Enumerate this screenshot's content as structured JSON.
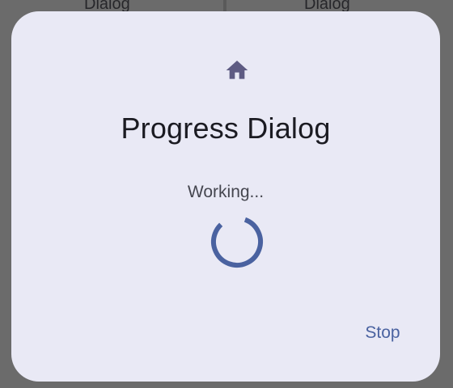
{
  "background": {
    "left_label": "Dialog",
    "right_label": "Dialog"
  },
  "dialog": {
    "icon": "home-icon",
    "title": "Progress Dialog",
    "message": "Working...",
    "progress_indicator": "indeterminate-circular",
    "stop_label": "Stop"
  },
  "colors": {
    "scrim": "#6b6b6b",
    "surface": "#e9e9f5",
    "icon": "#5e5b83",
    "title": "#1b1b22",
    "message": "#45464f",
    "spinner": "#4a62a0",
    "button_text": "#4a62a0"
  }
}
